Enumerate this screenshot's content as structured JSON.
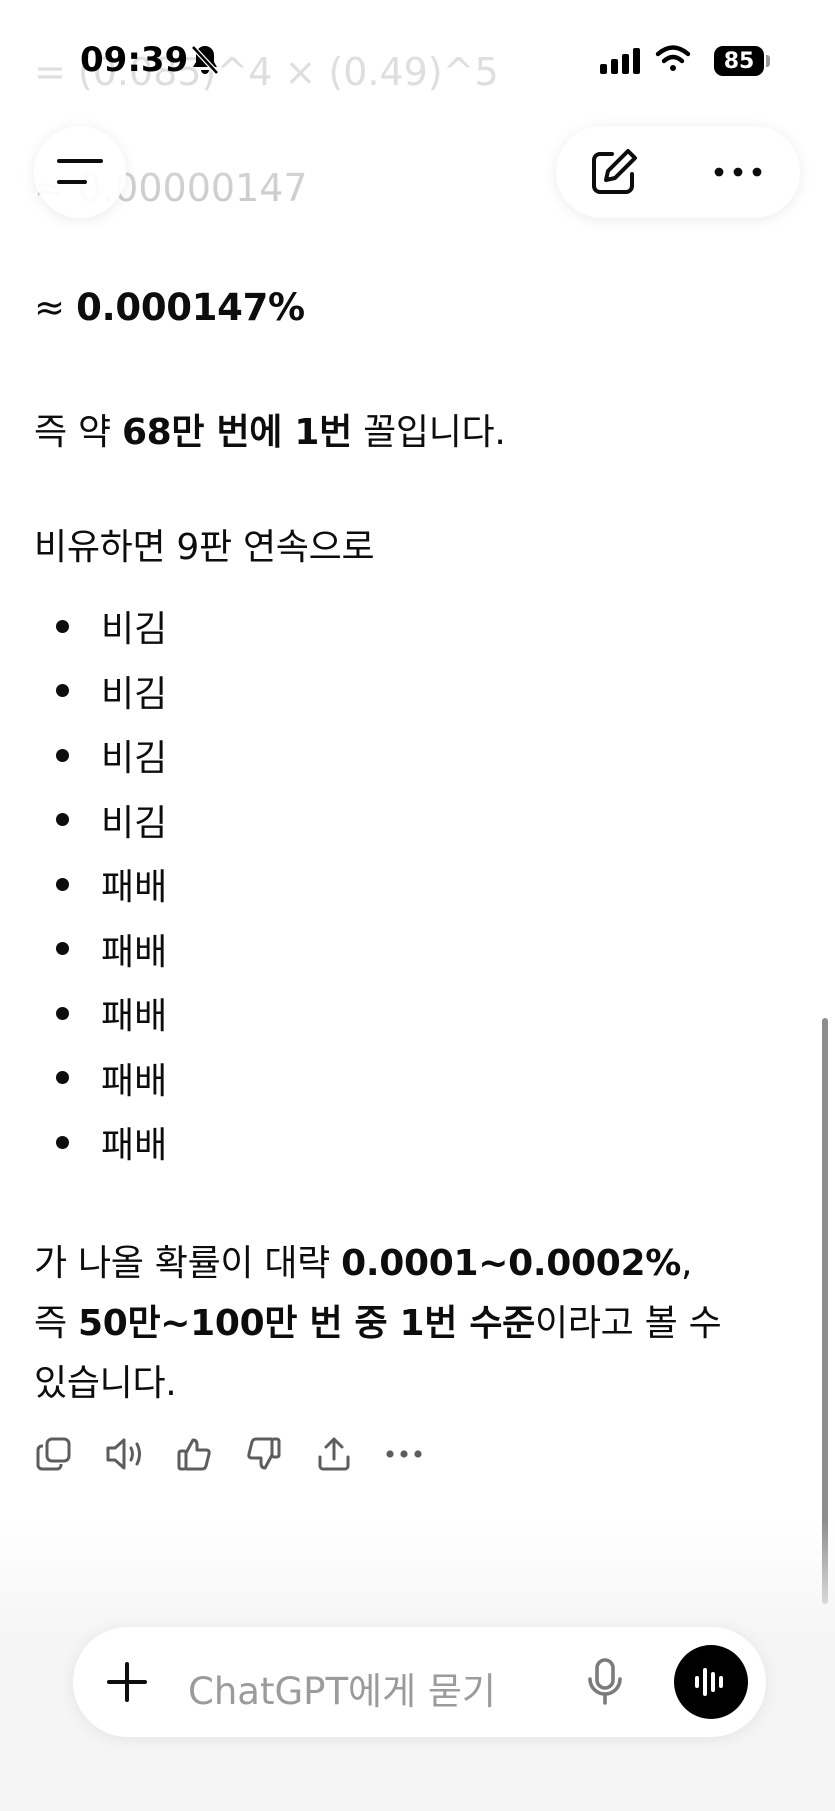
{
  "status_bar": {
    "time": "09:39",
    "battery": "85"
  },
  "message": {
    "faded_line_1": "= (0.085)^4 × (0.49)^5",
    "faded_line_2": "≈ 0.00000147",
    "result_prefix": "≈ ",
    "result_value": "0.000147%",
    "summary": {
      "p1": "즉 약 ",
      "b1": "68만 번에 1번",
      "p2": " 꼴입니다."
    },
    "analogy_intro": "비유하면 9판 연속으로",
    "bullets": [
      "비김",
      "비김",
      "비김",
      "비김",
      "패배",
      "패배",
      "패배",
      "패배",
      "패배"
    ],
    "conclusion": {
      "p1": "가 나올 확률이 대략 ",
      "b1": "0.0001~0.0002%",
      "p2": ",",
      "p3": "즉 ",
      "b2": "50만~100만 번 중 1번 수준",
      "p4": "이라고 볼 수",
      "p5": "있습니다."
    }
  },
  "actions": [
    "copy-icon",
    "speaker-icon",
    "thumbs-up-icon",
    "thumbs-down-icon",
    "share-icon",
    "more-icon"
  ],
  "composer": {
    "placeholder": "ChatGPT에게 묻기"
  }
}
